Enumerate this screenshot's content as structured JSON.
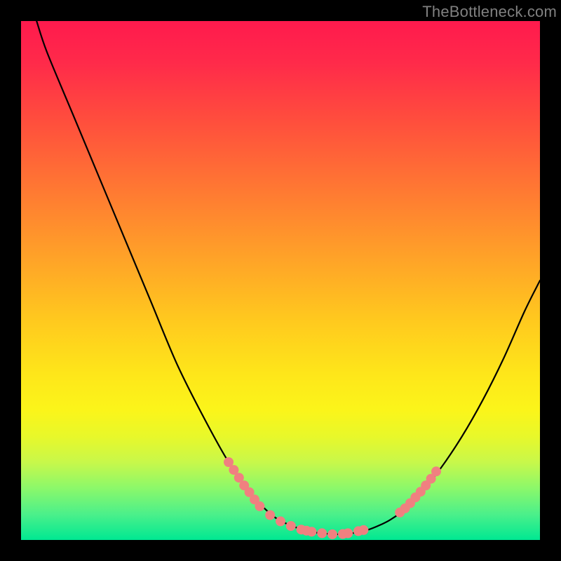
{
  "watermark": "TheBottleneck.com",
  "chart_data": {
    "type": "line",
    "title": "",
    "xlabel": "",
    "ylabel": "",
    "xlim": [
      0,
      100
    ],
    "ylim": [
      0,
      100
    ],
    "series": [
      {
        "name": "curve",
        "x": [
          3,
          5,
          10,
          15,
          20,
          25,
          30,
          35,
          40,
          45,
          47,
          49,
          51,
          53,
          55,
          57,
          59,
          61,
          63,
          65,
          67,
          69,
          71,
          73,
          77,
          81,
          85,
          89,
          93,
          97,
          100
        ],
        "values": [
          100,
          94,
          82,
          70,
          58,
          46,
          34,
          24,
          15,
          8,
          6,
          4.3,
          3.2,
          2.4,
          1.8,
          1.4,
          1.2,
          1.1,
          1.2,
          1.5,
          2.0,
          2.8,
          3.8,
          5.2,
          9,
          14,
          20,
          27,
          35,
          44,
          50
        ]
      }
    ],
    "markers": [
      {
        "x": 40,
        "y": 15
      },
      {
        "x": 41,
        "y": 13.5
      },
      {
        "x": 42,
        "y": 12
      },
      {
        "x": 43,
        "y": 10.5
      },
      {
        "x": 44,
        "y": 9.2
      },
      {
        "x": 45,
        "y": 7.8
      },
      {
        "x": 46,
        "y": 6.5
      },
      {
        "x": 48,
        "y": 4.8
      },
      {
        "x": 50,
        "y": 3.6
      },
      {
        "x": 52,
        "y": 2.7
      },
      {
        "x": 54,
        "y": 2.0
      },
      {
        "x": 55,
        "y": 1.8
      },
      {
        "x": 56,
        "y": 1.6
      },
      {
        "x": 58,
        "y": 1.3
      },
      {
        "x": 60,
        "y": 1.1
      },
      {
        "x": 62,
        "y": 1.15
      },
      {
        "x": 63,
        "y": 1.3
      },
      {
        "x": 65,
        "y": 1.7
      },
      {
        "x": 66,
        "y": 1.9
      },
      {
        "x": 73,
        "y": 5.3
      },
      {
        "x": 74,
        "y": 6.1
      },
      {
        "x": 75,
        "y": 7.1
      },
      {
        "x": 76,
        "y": 8.2
      },
      {
        "x": 77,
        "y": 9.3
      },
      {
        "x": 78,
        "y": 10.5
      },
      {
        "x": 79,
        "y": 11.8
      },
      {
        "x": 80,
        "y": 13.2
      }
    ],
    "colors": {
      "curve": "#000000",
      "markers": "#f08080",
      "gradient_top": "#ff1a4d",
      "gradient_bottom": "#00e892"
    }
  }
}
